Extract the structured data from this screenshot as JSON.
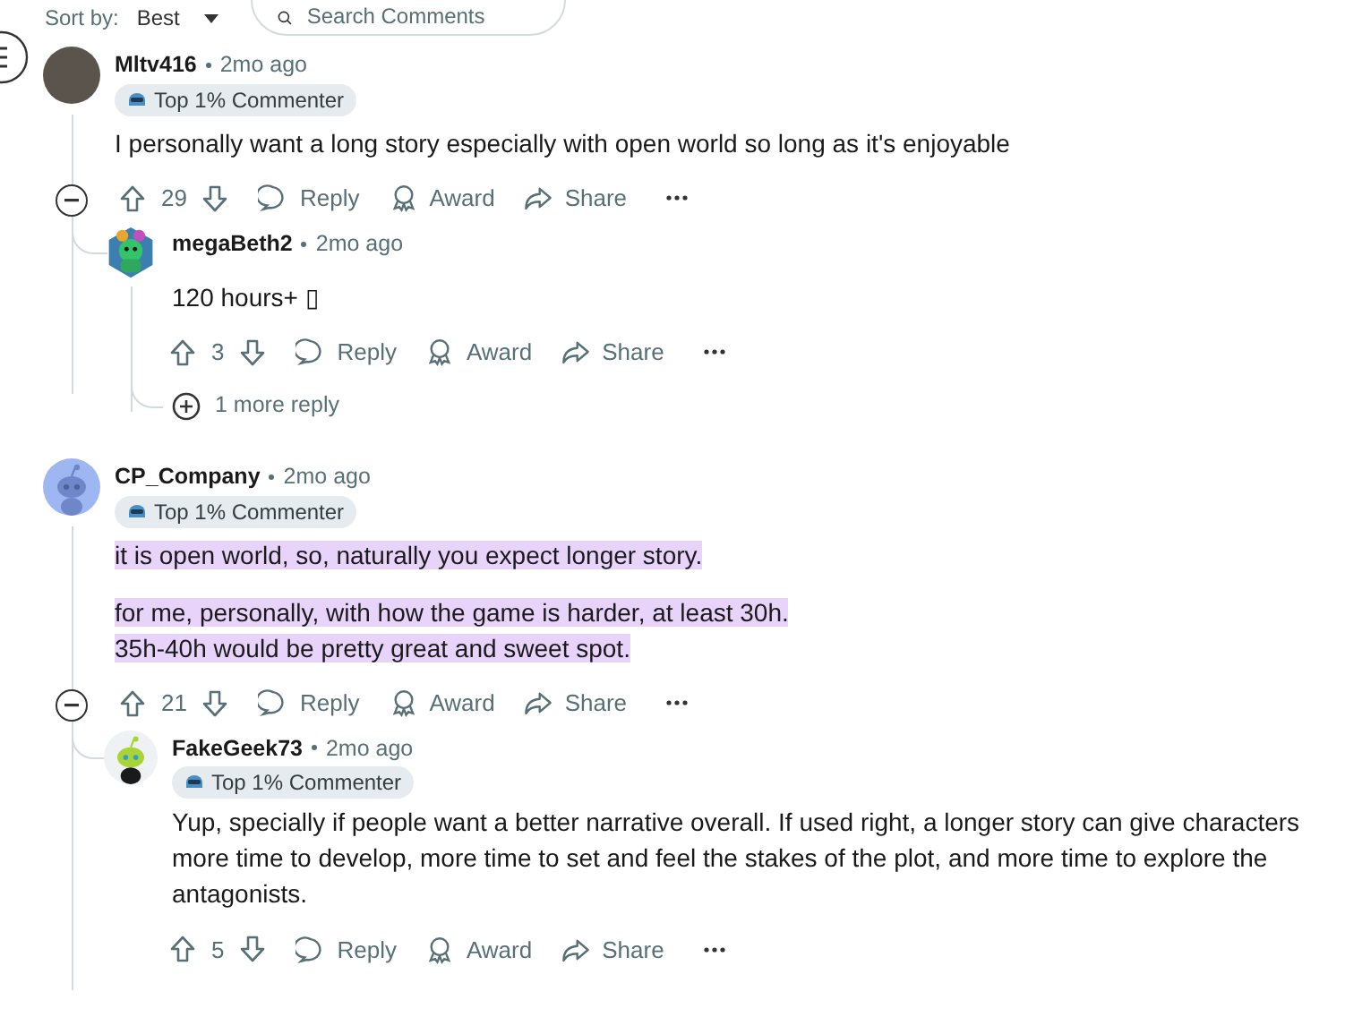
{
  "toolbar": {
    "sort_label": "Sort by:",
    "sort_value": "Best",
    "search": {
      "placeholder": "Search Comments"
    }
  },
  "comments": [
    {
      "author": "Mltv416",
      "time": "2mo ago",
      "kind": "photo",
      "badge": "Top 1% Commenter",
      "body": [
        "I personally want a long story especially with open world so long as it's enjoyable"
      ],
      "highlighted": false,
      "votes": "29",
      "actions": [
        "Reply",
        "Award",
        "Share"
      ],
      "thread_continues": false,
      "replies": [
        {
          "author": "megaBeth2",
          "time": "2mo ago",
          "kind": "mascot",
          "body": [
            "120 hours+ ▯"
          ],
          "highlighted": false,
          "votes": "3",
          "actions": [
            "Reply",
            "Award",
            "Share"
          ],
          "more_replies": "1 more reply"
        }
      ]
    },
    {
      "author": "CP_Company",
      "time": "2mo ago",
      "kind": "snoo-blue",
      "badge": "Top 1% Commenter",
      "body": [
        "it is open world, so, naturally you expect longer story.",
        "for me, personally, with how the game is harder, at least 30h.\n35h-40h would be pretty great and sweet spot."
      ],
      "highlighted": true,
      "votes": "21",
      "actions": [
        "Reply",
        "Award",
        "Share"
      ],
      "thread_continues": true,
      "replies": [
        {
          "author": "FakeGeek73",
          "time": "2mo ago",
          "kind": "snoo-green",
          "badge": "Top 1% Commenter",
          "body": [
            "Yup, specially if people want a better narrative overall. If used right, a longer story can give characters more time to develop, more time to set and feel the stakes of the plot, and more time to explore the antagonists."
          ],
          "highlighted": false,
          "votes": "5",
          "actions": [
            "Reply",
            "Award",
            "Share"
          ]
        }
      ]
    }
  ]
}
